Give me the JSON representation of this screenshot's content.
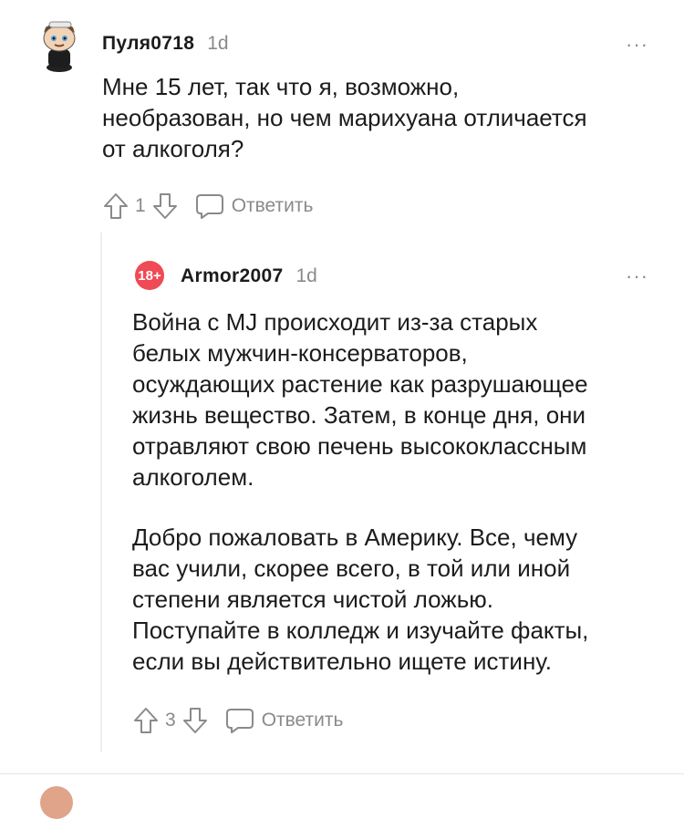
{
  "comments": [
    {
      "username": "Пуля0718",
      "time": "1d",
      "more": "···",
      "text": "Мне 15 лет, так что я, возможно,\nнеобразован, но чем марихуана отличается\nот алкоголя?",
      "votes": "1",
      "reply_label": "Ответить",
      "avatar_icon": "snoo-avatar"
    },
    {
      "username": "Armor2007",
      "time": "1d",
      "more": "···",
      "badge": "18+",
      "paragraph1": "Война с MJ происходит из-за старых\nбелых мужчин-консерваторов,\nосуждающих растение как разрушающее\nжизнь вещество. Затем, в конце дня, они\nотравляют свою печень высококлассным\nалкоголем.",
      "paragraph2": "Добро пожаловать в Америку. Все, чему\nвас учили, скорее всего, в той или иной\nстепени является чистой ложью.\nПоступайте в колледж и изучайте факты,\nесли вы действительно ищете истину.",
      "votes": "3",
      "reply_label": "Ответить"
    }
  ],
  "colors": {
    "meta": "#8a8a8a",
    "badge": "#ef4a55",
    "text": "#1c1c1c"
  }
}
